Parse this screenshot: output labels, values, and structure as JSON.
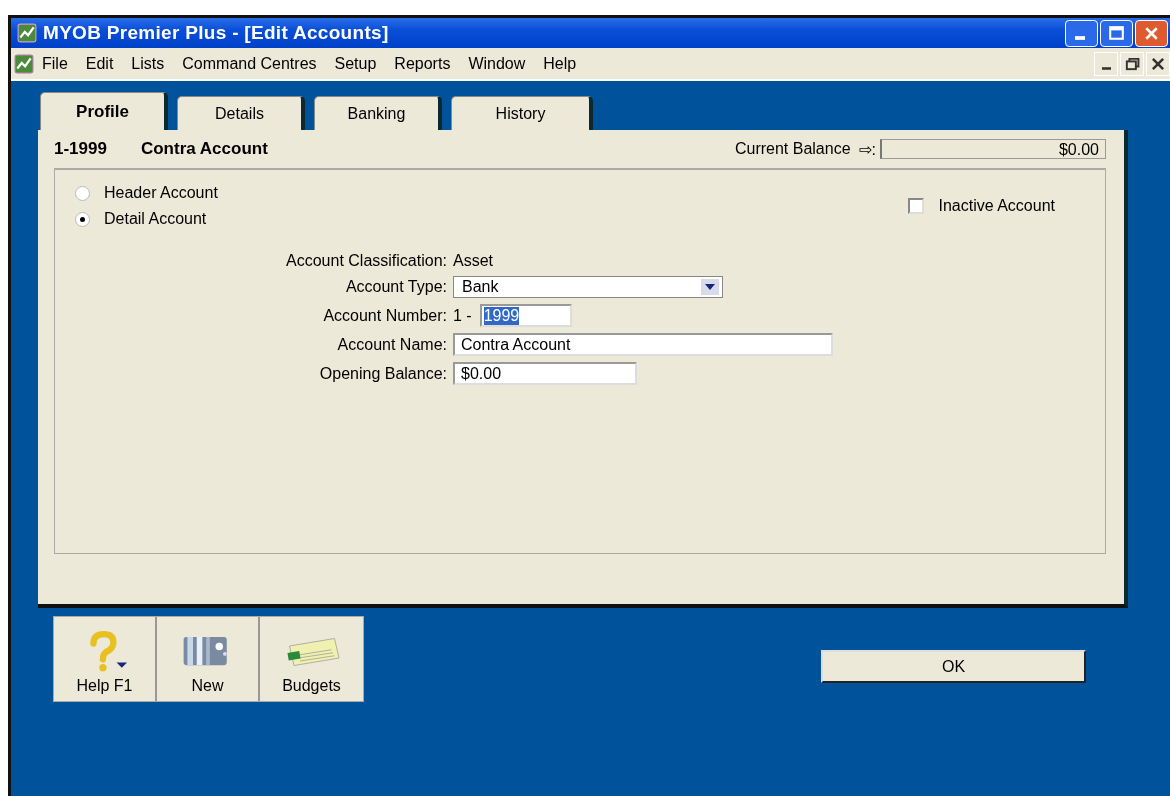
{
  "window": {
    "title": "MYOB Premier Plus - [Edit Accounts]"
  },
  "menu": [
    "File",
    "Edit",
    "Lists",
    "Command Centres",
    "Setup",
    "Reports",
    "Window",
    "Help"
  ],
  "tabs": [
    {
      "label": "Profile",
      "selected": true
    },
    {
      "label": "Details",
      "selected": false
    },
    {
      "label": "Banking",
      "selected": false
    },
    {
      "label": "History",
      "selected": false
    }
  ],
  "header": {
    "account_number": "1-1999",
    "account_name": "Contra Account",
    "balance_label": "Current Balance",
    "balance_arrow": "⇨:",
    "balance": "$0.00"
  },
  "account_level": [
    {
      "label": "Header Account",
      "selected": false
    },
    {
      "label": "Detail Account",
      "selected": true
    }
  ],
  "inactive": {
    "label": "Inactive Account",
    "checked": false
  },
  "form": {
    "classification_label": "Account Classification:",
    "classification": "Asset",
    "type_label": "Account Type:",
    "type": "Bank",
    "number_label": "Account Number:",
    "number_prefix": "1 -",
    "number": "1999",
    "name_label": "Account Name:",
    "name": "Contra Account",
    "opening_label": "Opening Balance:",
    "opening": "$0.00"
  },
  "toolbar": [
    {
      "kind": "help",
      "label": "Help F1"
    },
    {
      "kind": "new",
      "label": "New"
    },
    {
      "kind": "budgets",
      "label": "Budgets"
    }
  ],
  "ok_button": "OK"
}
